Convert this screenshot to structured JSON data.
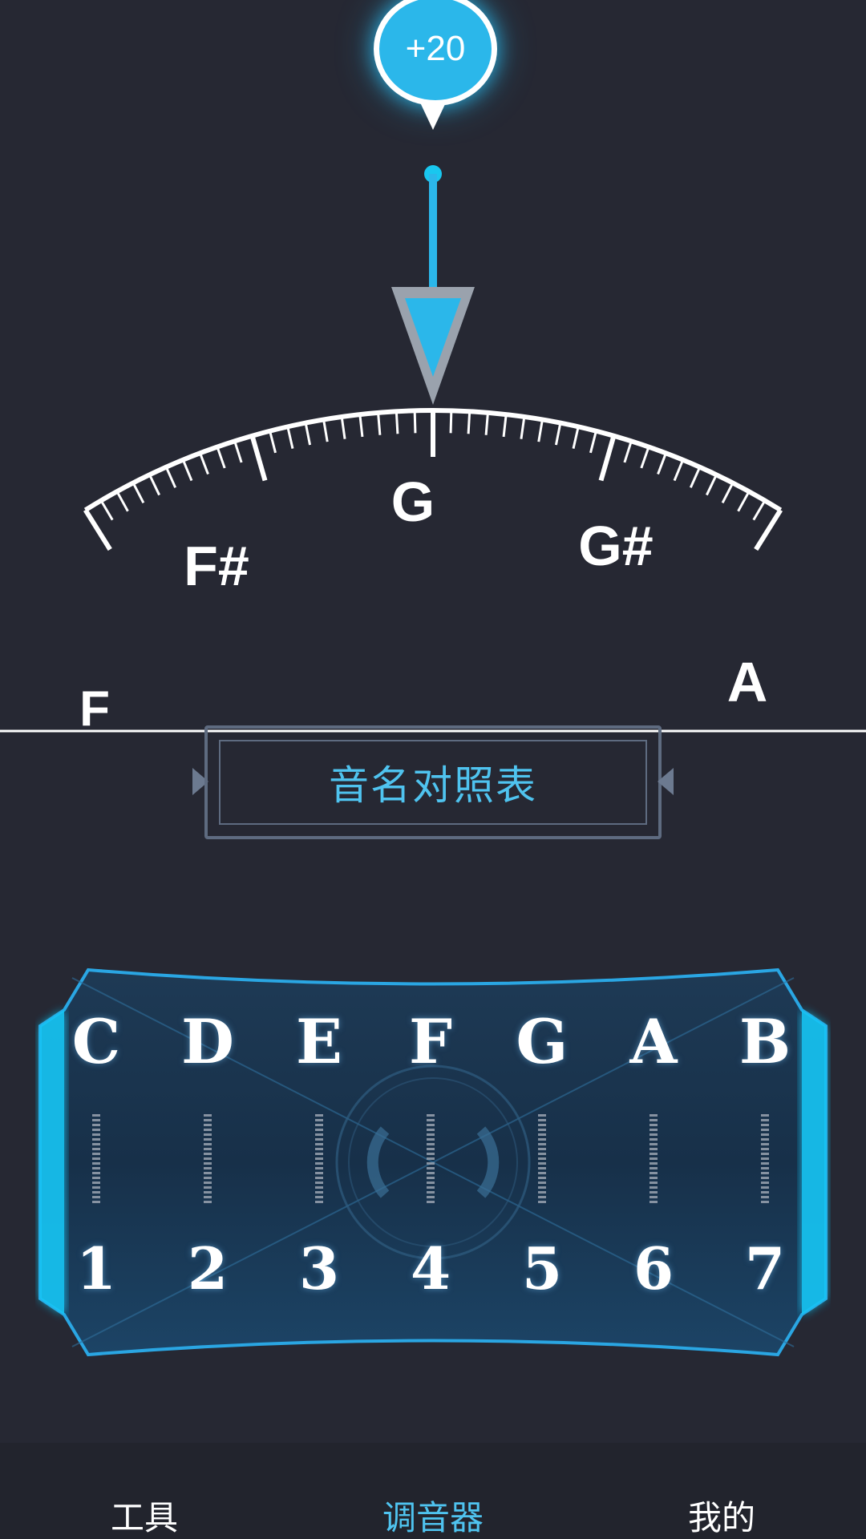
{
  "tuner": {
    "cents_offset": "+20",
    "current_note": "G",
    "dial_notes": [
      "F",
      "F#",
      "G",
      "G#",
      "A"
    ]
  },
  "reference_button": {
    "label": "音名对照表"
  },
  "note_table": {
    "letters": [
      "C",
      "D",
      "E",
      "F",
      "G",
      "A",
      "B"
    ],
    "numbers": [
      "1",
      "2",
      "3",
      "4",
      "5",
      "6",
      "7"
    ]
  },
  "bottom_nav": {
    "items": [
      {
        "label": "工具",
        "active": false
      },
      {
        "label": "调音器",
        "active": true
      },
      {
        "label": "我的",
        "active": false
      }
    ]
  },
  "colors": {
    "background": "#262833",
    "accent": "#2bb7ea",
    "active_nav": "#4fc3ef"
  }
}
